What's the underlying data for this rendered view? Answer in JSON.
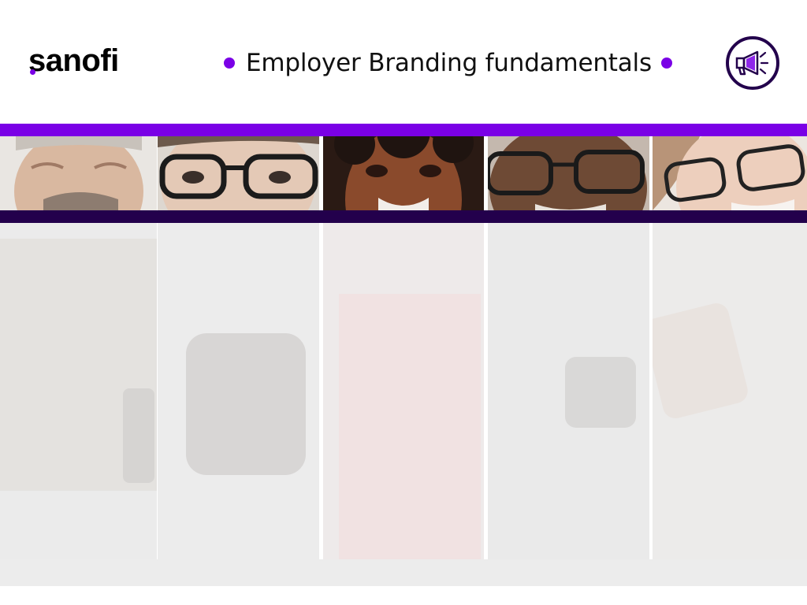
{
  "header": {
    "logo_text": "sanofi",
    "title": "Employer Branding fundamentals",
    "icon": "megaphone-icon"
  },
  "colors": {
    "accent_purple": "#7a00e6",
    "dark_purple": "#23004c",
    "footer_grey": "#ececec"
  },
  "photos": [
    {
      "name": "person-1-smiling-man"
    },
    {
      "name": "person-2-woman-glasses"
    },
    {
      "name": "person-3-smiling-woman"
    },
    {
      "name": "person-4-man-glasses"
    },
    {
      "name": "person-5-woman-glasses"
    }
  ]
}
